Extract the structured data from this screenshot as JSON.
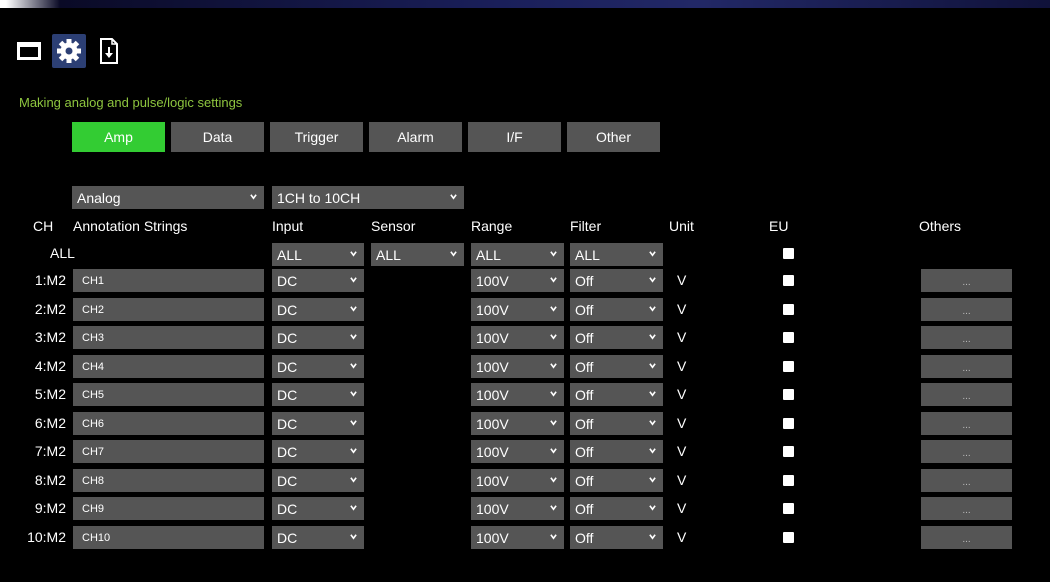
{
  "toolbar": {
    "buttons": [
      {
        "icon": "window-icon"
      },
      {
        "icon": "gear-icon",
        "active": true
      },
      {
        "icon": "file-download-icon"
      }
    ]
  },
  "subtitle": "Making analog and pulse/logic settings",
  "tabs": [
    "Amp",
    "Data",
    "Trigger",
    "Alarm",
    "I/F",
    "Other"
  ],
  "active_tab": "Amp",
  "filters": {
    "module": "Analog",
    "channel_range": "1CH to 10CH"
  },
  "headers": {
    "ch": "CH",
    "annotation": "Annotation Strings",
    "input": "Input",
    "sensor": "Sensor",
    "range": "Range",
    "filter": "Filter",
    "unit": "Unit",
    "eu": "EU",
    "others": "Others"
  },
  "all_row": {
    "label": "ALL",
    "input": "ALL",
    "sensor": "ALL",
    "range": "ALL",
    "filter": "ALL"
  },
  "rows": [
    {
      "ch": "1:M2",
      "annotation": "CH1",
      "input": "DC",
      "range": "100V",
      "filter": "Off",
      "unit": "V",
      "others": "..."
    },
    {
      "ch": "2:M2",
      "annotation": "CH2",
      "input": "DC",
      "range": "100V",
      "filter": "Off",
      "unit": "V",
      "others": "..."
    },
    {
      "ch": "3:M2",
      "annotation": "CH3",
      "input": "DC",
      "range": "100V",
      "filter": "Off",
      "unit": "V",
      "others": "..."
    },
    {
      "ch": "4:M2",
      "annotation": "CH4",
      "input": "DC",
      "range": "100V",
      "filter": "Off",
      "unit": "V",
      "others": "..."
    },
    {
      "ch": "5:M2",
      "annotation": "CH5",
      "input": "DC",
      "range": "100V",
      "filter": "Off",
      "unit": "V",
      "others": "..."
    },
    {
      "ch": "6:M2",
      "annotation": "CH6",
      "input": "DC",
      "range": "100V",
      "filter": "Off",
      "unit": "V",
      "others": "..."
    },
    {
      "ch": "7:M2",
      "annotation": "CH7",
      "input": "DC",
      "range": "100V",
      "filter": "Off",
      "unit": "V",
      "others": "..."
    },
    {
      "ch": "8:M2",
      "annotation": "CH8",
      "input": "DC",
      "range": "100V",
      "filter": "Off",
      "unit": "V",
      "others": "..."
    },
    {
      "ch": "9:M2",
      "annotation": "CH9",
      "input": "DC",
      "range": "100V",
      "filter": "Off",
      "unit": "V",
      "others": "..."
    },
    {
      "ch": "10:M2",
      "annotation": "CH10",
      "input": "DC",
      "range": "100V",
      "filter": "Off",
      "unit": "V",
      "others": "..."
    }
  ],
  "colors": {
    "accent_green": "#33cc33",
    "subtitle_green": "#8ec63f",
    "control_gray": "#555555",
    "background": "#000000"
  }
}
